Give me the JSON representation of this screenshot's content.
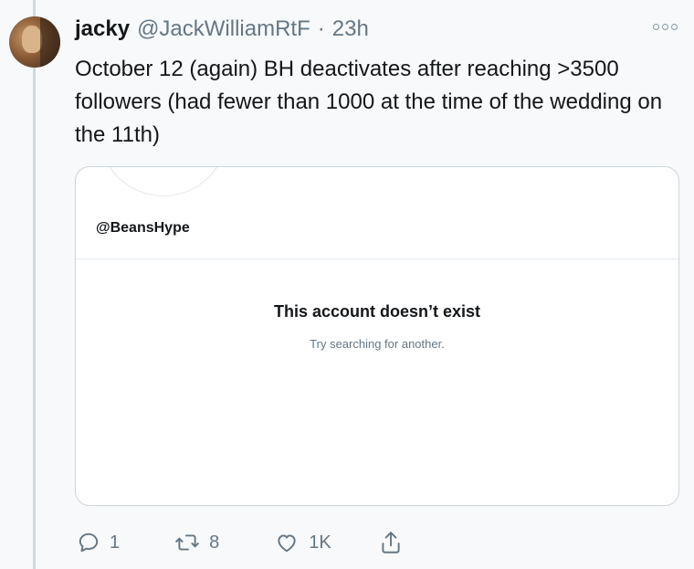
{
  "tweet": {
    "author_name": "jacky",
    "author_handle": "@JackWilliamRtF",
    "separator": "·",
    "time": "23h",
    "text": "October 12 (again) BH deactivates after reaching >3500 followers (had fewer than 1000 at the time of the wedding on the 11th)"
  },
  "embedded_card": {
    "handle": "@BeansHype",
    "title": "This account doesn’t exist",
    "subtitle": "Try searching for another."
  },
  "actions": {
    "reply_count": "1",
    "retweet_count": "8",
    "like_count": "1K"
  },
  "icons": {
    "more": "more-options-icon",
    "reply": "reply-icon",
    "retweet": "retweet-icon",
    "like": "heart-icon",
    "share": "share-icon"
  }
}
